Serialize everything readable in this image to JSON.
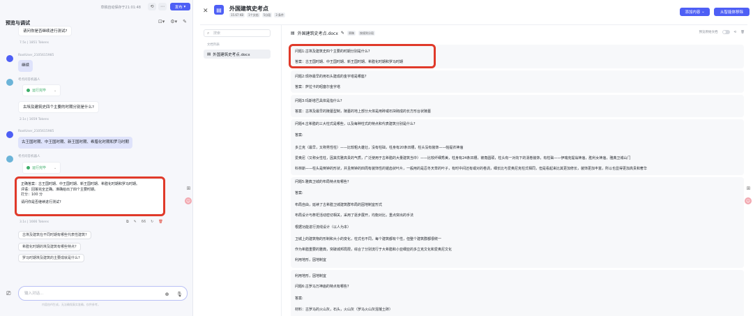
{
  "left_panel": {
    "saved_text": "草稿自动保存于21:01:48",
    "publish_label": "发布",
    "title": "预览与调试",
    "messages": {
      "prev_question": "请问你是否继续进行测试?",
      "prev_meta": "7.5s  |  1851 Tokens",
      "user_name_1": "RootUser_2105615985",
      "user_msg_1": "继续",
      "bot_name_1": "考点问答机器人",
      "running_1": "运行完毕",
      "bot_msg_1": "古埃及建筑史四个主要的时期分别是什么?",
      "meta_1": "2.1s  |  1659 Tokens",
      "user_name_2": "RootUser_2105615985",
      "user_msg_2": "古王国时期、中王国时期、新王国时期、希腊化时期和罗马时期",
      "bot_name_2": "考点问答机器人",
      "running_2": "运行完毕",
      "answer_lines": [
        "正确答案：古王国时期、中王国时期、新王国时期、希腊化时期和罗马时期。",
        "评语：回答完全正确。准确给出了四个主要时期。",
        "打分：100 分",
        "请问你是否继续进行测试?"
      ],
      "meta_2": "3.1s  |  1666 Tokens",
      "answer_actions": [
        "⧉",
        "✎",
        "66",
        "↻",
        "🗑"
      ]
    },
    "suggestions": [
      "古埃及建筑在不同时期有哪些代表性建筑?",
      "希腊化时期的埃及建筑有哪些特点?",
      "罗马时期埃及建筑的主要成就是什么?"
    ],
    "input_placeholder": "输入对话...",
    "disclaimer": "内容由AI生成，无法确保真实准确，仅供参考。"
  },
  "right_panel": {
    "kb_title": "外国建筑史考点",
    "kb_tags": [
      "15.67 KB",
      "1个文档",
      "5分段",
      "3 条件"
    ],
    "add_content_label": "添加内容",
    "remove_label": "从智能体移除",
    "search_placeholder": "搜索",
    "file_list_label": "文档列表",
    "file_name": "外国建筑史考点.docx",
    "doc_name": "外国建筑史考点.docx",
    "doc_tags": [
      "原稿",
      "按规则分段"
    ],
    "preview_label": "预览原始文档",
    "chunks": [
      {
        "lines": [
          "问题1:古埃及建筑史四个主要的时期分别是什么?",
          "答案：古王国时期、中王国时期、新王国时期、希腊化时期和罗马时期"
        ]
      },
      {
        "lines": [
          "问题2:现存最早的用石头建成的金字塔是哪座?",
          "答案：萨拉卡的昭塞尔金字塔"
        ]
      },
      {
        "lines": [
          "问题3:玛斯塔巴具体是指什么?",
          "答案：古埃及最早的陵墓型制，陵墓的地上部分大体是用砖或石块砌成的长方形台状陵墓"
        ]
      },
      {
        "lines": [
          "问题4:古希腊的三大柱式是哪些，以及每种柱式的特点和代表建筑分别是什么?",
          "答案:",
          "多立克（最早，又称男性柱）——比较粗大雄壮，没有柱础，柱身有20条凹槽，柱头没有装饰——帕提农神庙",
          "爱奥尼（又称女性柱，因其优雅高贵的气质，广泛使用于古希腊的大量建筑当中）——比较纤细秀美，柱身有24条凹槽，被角圆硕，柱头有一对向下的涡卷装饰，有柱础——伊瑞克提翁神庙，胜利女神庙，雅典卫城山门",
          "科林斯——柱头是倒钟的形状，并且倒钟的四周有装饰性的锯齿状叶片，一般用的是忍冬天草的叶子，有时中间还有或对的卷涡，细长比与爱奥尼克柱式相同，但是看起来比其更加修长，装饰更加丰富，所以也显得更加高贵和奢华"
        ]
      },
      {
        "lines": [
          "问题5:雅典卫城的布局特点有哪些?",
          "答案:",
          "布局自由，延续了古希腊卫城建筑群布局的因地制宜形式",
          "布局设计与祭祀活动密切相关，采用了逐步展开，均衡对比，重点突出的手法",
          "根据功能进行流线设计（以人为本）",
          "卫城上的建筑物的形制和大小的变化，柱式也不同，每个建筑都有个性，但整个建筑群都很统一",
          "作为希腊重要的雅典，突破城邦局限，综合了分别流行于大希腊和小亚细亚的多立克文化和爱奥尼文化",
          "利用地形，因地制宜"
        ]
      },
      {
        "lines": [
          "利用地形，因地制宜",
          "问题6:古罗马万神庙的特点有哪些?",
          "答案:",
          "材料：古罗马的火山灰，石头，火山灰（罗马火山灰混凝土砖）"
        ]
      }
    ]
  }
}
